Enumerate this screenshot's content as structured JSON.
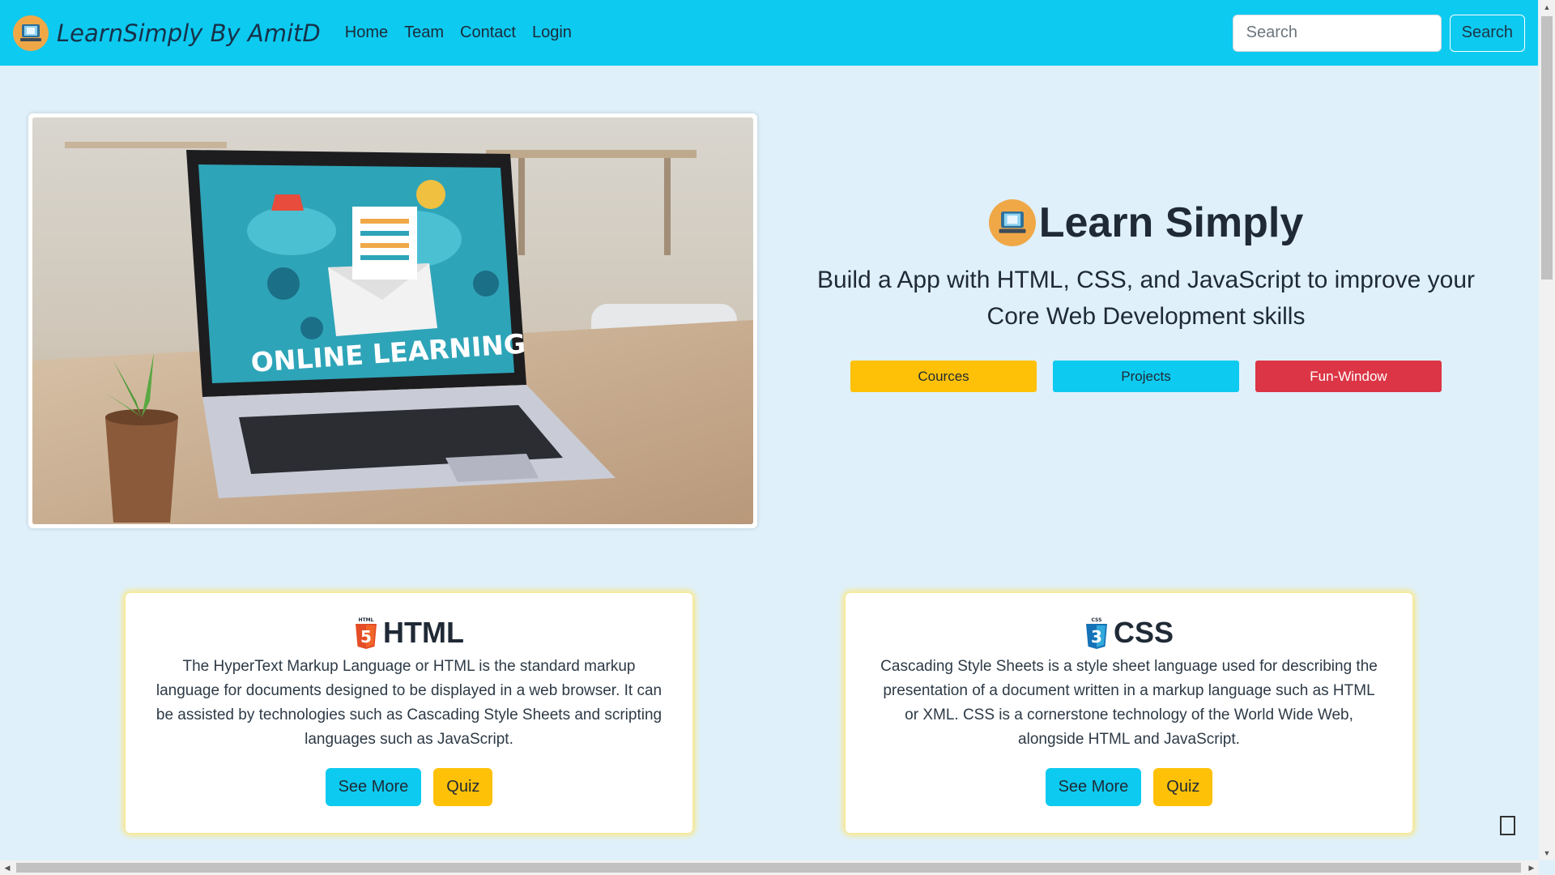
{
  "navbar": {
    "brand": "LearnSimply By AmitD",
    "brand_icon": "book-laptop-icon",
    "links": [
      "Home",
      "Team",
      "Contact",
      "Login"
    ],
    "search_placeholder": "Search",
    "search_button": "Search"
  },
  "hero": {
    "image_text": "ONLINE LEARNING",
    "title": "Learn Simply",
    "subtitle": "Build a App with HTML, CSS, and JavaScript to improve your Core Web Development skills",
    "buttons": [
      "Cources",
      "Projects",
      "Fun-Window"
    ]
  },
  "cards": [
    {
      "icon": "html5-icon",
      "icon_text": "HTML",
      "title": "HTML",
      "description": "The HyperText Markup Language or HTML is the standard markup language for documents designed to be displayed in a web browser. It can be assisted by technologies such as Cascading Style Sheets and scripting languages such as JavaScript.",
      "see_more": "See More",
      "quiz": "Quiz"
    },
    {
      "icon": "css3-icon",
      "icon_text": "CSS",
      "title": "CSS",
      "description": "Cascading Style Sheets is a style sheet language used for describing the presentation of a document written in a markup language such as HTML or XML. CSS is a cornerstone technology of the World Wide Web, alongside HTML and JavaScript.",
      "see_more": "See More",
      "quiz": "Quiz"
    }
  ],
  "colors": {
    "navbar": "#0dcaf0",
    "background": "#dff0fb",
    "yellow": "#ffc107",
    "cyan": "#0dcaf0",
    "red": "#dc3545"
  }
}
